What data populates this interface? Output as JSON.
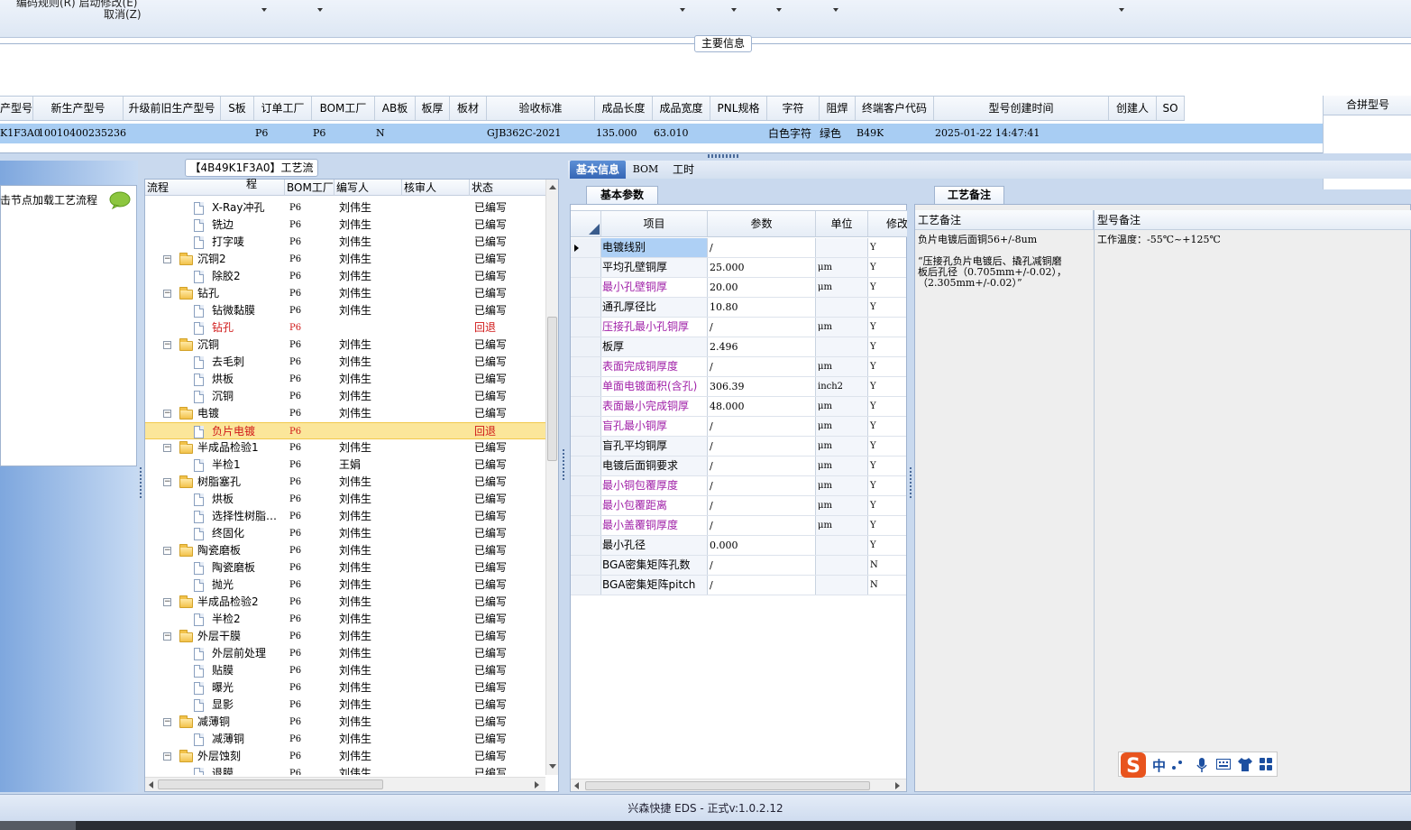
{
  "toolbar": {
    "menu_partial": "编码规则(R)    启动修改(E)",
    "cancel": "取消(Z)"
  },
  "main_info": {
    "caption": "主要信息",
    "columns": [
      "产型号",
      "新生产型号",
      "升级前旧生产型号",
      "S板",
      "订单工厂",
      "BOM工厂",
      "AB板",
      "板厚",
      "板材",
      "验收标准",
      "成品长度",
      "成品宽度",
      "PNL规格",
      "字符",
      "阻焊",
      "终端客户代码",
      "型号创建时间",
      "创建人",
      "SO"
    ],
    "row": {
      "model": "K1F3A0",
      "new_model": "10010400235236",
      "order_factory": "P6",
      "bom_factory": "P6",
      "ab": "N",
      "standard": "GJB362C-2021",
      "length": "135.000",
      "width": "63.010",
      "char": "白色字符",
      "mask": "绿色",
      "customer": "B49K",
      "created": "2025-01-22 14:47:41"
    },
    "combine_header": "合拼型号"
  },
  "left_nav": {
    "hint": "击节点加载工艺流程"
  },
  "tree": {
    "caption": "【4B49K1F3A0】工艺流程",
    "headers": [
      "流程",
      "BOM工厂",
      "编写人",
      "核审人",
      "状态"
    ],
    "rows": [
      {
        "label": "X-Ray冲孔",
        "bom": "P6",
        "writer": "刘伟生",
        "status": "已编写",
        "level": 2
      },
      {
        "label": "铣边",
        "bom": "P6",
        "writer": "刘伟生",
        "status": "已编写",
        "level": 2
      },
      {
        "label": "打字唛",
        "bom": "P6",
        "writer": "刘伟生",
        "status": "已编写",
        "level": 2
      },
      {
        "label": "沉铜2",
        "bom": "P6",
        "writer": "刘伟生",
        "status": "已编写",
        "level": 1
      },
      {
        "label": "除胶2",
        "bom": "P6",
        "writer": "刘伟生",
        "status": "已编写",
        "level": 2
      },
      {
        "label": "钻孔",
        "bom": "P6",
        "writer": "刘伟生",
        "status": "已编写",
        "level": 1
      },
      {
        "label": "钻微黏膜",
        "bom": "P6",
        "writer": "刘伟生",
        "status": "已编写",
        "level": 2
      },
      {
        "label": "钻孔",
        "bom": "P6",
        "writer": "",
        "status": "回退",
        "level": 2,
        "red": true
      },
      {
        "label": "沉铜",
        "bom": "P6",
        "writer": "刘伟生",
        "status": "已编写",
        "level": 1
      },
      {
        "label": "去毛刺",
        "bom": "P6",
        "writer": "刘伟生",
        "status": "已编写",
        "level": 2
      },
      {
        "label": "烘板",
        "bom": "P6",
        "writer": "刘伟生",
        "status": "已编写",
        "level": 2
      },
      {
        "label": "沉铜",
        "bom": "P6",
        "writer": "刘伟生",
        "status": "已编写",
        "level": 2
      },
      {
        "label": "电镀",
        "bom": "P6",
        "writer": "刘伟生",
        "status": "已编写",
        "level": 1
      },
      {
        "label": "负片电镀",
        "bom": "P6",
        "writer": "",
        "status": "回退",
        "level": 2,
        "red": true,
        "selected": true
      },
      {
        "label": "半成品检验1",
        "bom": "P6",
        "writer": "刘伟生",
        "status": "已编写",
        "level": 1
      },
      {
        "label": "半检1",
        "bom": "P6",
        "writer": "王娟",
        "status": "已编写",
        "level": 2
      },
      {
        "label": "树脂塞孔",
        "bom": "P6",
        "writer": "刘伟生",
        "status": "已编写",
        "level": 1
      },
      {
        "label": "烘板",
        "bom": "P6",
        "writer": "刘伟生",
        "status": "已编写",
        "level": 2
      },
      {
        "label": "选择性树脂…",
        "bom": "P6",
        "writer": "刘伟生",
        "status": "已编写",
        "level": 2
      },
      {
        "label": "终固化",
        "bom": "P6",
        "writer": "刘伟生",
        "status": "已编写",
        "level": 2
      },
      {
        "label": "陶瓷磨板",
        "bom": "P6",
        "writer": "刘伟生",
        "status": "已编写",
        "level": 1
      },
      {
        "label": "陶瓷磨板",
        "bom": "P6",
        "writer": "刘伟生",
        "status": "已编写",
        "level": 2
      },
      {
        "label": "抛光",
        "bom": "P6",
        "writer": "刘伟生",
        "status": "已编写",
        "level": 2
      },
      {
        "label": "半成品检验2",
        "bom": "P6",
        "writer": "刘伟生",
        "status": "已编写",
        "level": 1
      },
      {
        "label": "半检2",
        "bom": "P6",
        "writer": "刘伟生",
        "status": "已编写",
        "level": 2
      },
      {
        "label": "外层干膜",
        "bom": "P6",
        "writer": "刘伟生",
        "status": "已编写",
        "level": 1
      },
      {
        "label": "外层前处理",
        "bom": "P6",
        "writer": "刘伟生",
        "status": "已编写",
        "level": 2
      },
      {
        "label": "贴膜",
        "bom": "P6",
        "writer": "刘伟生",
        "status": "已编写",
        "level": 2
      },
      {
        "label": "曝光",
        "bom": "P6",
        "writer": "刘伟生",
        "status": "已编写",
        "level": 2
      },
      {
        "label": "显影",
        "bom": "P6",
        "writer": "刘伟生",
        "status": "已编写",
        "level": 2
      },
      {
        "label": "减薄铜",
        "bom": "P6",
        "writer": "刘伟生",
        "status": "已编写",
        "level": 1
      },
      {
        "label": "减薄铜",
        "bom": "P6",
        "writer": "刘伟生",
        "status": "已编写",
        "level": 2
      },
      {
        "label": "外层蚀刻",
        "bom": "P6",
        "writer": "刘伟生",
        "status": "已编写",
        "level": 1
      },
      {
        "label": "退膜",
        "bom": "P6",
        "writer": "刘伟生",
        "status": "已编写",
        "level": 2
      }
    ]
  },
  "tabs": [
    "基本信息",
    "BOM",
    "工时"
  ],
  "params": {
    "caption": "基本参数",
    "headers": [
      "项目",
      "参数",
      "单位",
      "修改"
    ],
    "rows": [
      {
        "item": "电镀线别",
        "param": "/",
        "unit": "",
        "mod": "Y",
        "cur": true
      },
      {
        "item": "平均孔壁铜厚",
        "param": "25.000",
        "unit": "μm",
        "mod": "Y"
      },
      {
        "item": "最小孔壁铜厚",
        "param": "20.00",
        "unit": "μm",
        "mod": "Y",
        "purple": true
      },
      {
        "item": "通孔厚径比",
        "param": "10.80",
        "unit": "",
        "mod": "Y"
      },
      {
        "item": "压接孔最小孔铜厚",
        "param": "/",
        "unit": "μm",
        "mod": "Y",
        "purple": true
      },
      {
        "item": "板厚",
        "param": "2.496",
        "unit": "",
        "mod": "Y"
      },
      {
        "item": "表面完成铜厚度",
        "param": "/",
        "unit": "μm",
        "mod": "Y",
        "purple": true
      },
      {
        "item": "单面电镀面积(含孔)",
        "param": "306.39",
        "unit": "inch2",
        "mod": "Y",
        "purple": true
      },
      {
        "item": "表面最小完成铜厚",
        "param": "48.000",
        "unit": "μm",
        "mod": "Y",
        "purple": true
      },
      {
        "item": "盲孔最小铜厚",
        "param": "/",
        "unit": "μm",
        "mod": "Y",
        "purple": true
      },
      {
        "item": "盲孔平均铜厚",
        "param": "/",
        "unit": "μm",
        "mod": "Y"
      },
      {
        "item": "电镀后面铜要求",
        "param": "/",
        "unit": "μm",
        "mod": "Y"
      },
      {
        "item": "最小铜包覆厚度",
        "param": "/",
        "unit": "μm",
        "mod": "Y",
        "purple": true
      },
      {
        "item": "最小包覆距离",
        "param": "/",
        "unit": "μm",
        "mod": "Y",
        "purple": true
      },
      {
        "item": "最小盖覆铜厚度",
        "param": "/",
        "unit": "μm",
        "mod": "Y",
        "purple": true
      },
      {
        "item": "最小孔径",
        "param": "0.000",
        "unit": "",
        "mod": "Y"
      },
      {
        "item": "BGA密集矩阵孔数",
        "param": "/",
        "unit": "",
        "mod": "N"
      },
      {
        "item": "BGA密集矩阵pitch",
        "param": "/",
        "unit": "",
        "mod": "N"
      }
    ]
  },
  "notes": {
    "caption": "工艺备注",
    "left_header": "工艺备注",
    "right_header": "型号备注",
    "left_lines": [
      "负片电镀后面铜56+/-8um",
      "",
      "“压接孔负片电镀后、撬孔减铜磨",
      "板后孔径（0.705mm+/-0.02），",
      "（2.305mm+/-0.02）”"
    ],
    "right_text": "工作温度：-55℃~+125℃"
  },
  "ime": {
    "label": "中"
  },
  "status": {
    "text": "兴森快捷 EDS - 正式v:1.0.2.12"
  },
  "colors": {
    "selection_blue": "#a8cdf3",
    "tree_selected": "#fbe69a",
    "rollback_red": "#d01818",
    "purple_item": "#a020a8"
  }
}
